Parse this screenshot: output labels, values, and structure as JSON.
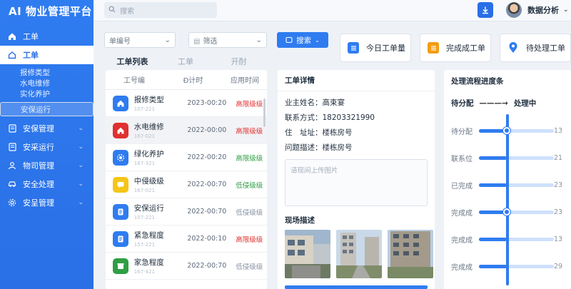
{
  "app": {
    "title": "AI 物业管理平台"
  },
  "search": {
    "placeholder": "搜索"
  },
  "user": {
    "name": "数据分析"
  },
  "sidebar": {
    "items": [
      {
        "label": "工单",
        "icon": "home-icon",
        "active": false,
        "chevron": false
      },
      {
        "label": "工单",
        "icon": "home-outline-icon",
        "active": true,
        "chevron": false
      },
      {
        "label": "安保管理",
        "icon": "doc-icon",
        "active": false,
        "chevron": true
      },
      {
        "label": "安采运行",
        "icon": "doc-icon",
        "active": false,
        "chevron": true
      },
      {
        "label": "物司管理",
        "icon": "person-icon",
        "active": false,
        "chevron": true
      },
      {
        "label": "安全处理",
        "icon": "car-icon",
        "active": false,
        "chevron": true
      },
      {
        "label": "安呈管理",
        "icon": "gear-icon",
        "active": false,
        "chevron": true
      }
    ],
    "subitems": [
      "报修类型",
      "水电维修",
      "实化养护",
      "安保运行"
    ],
    "selected_sub": "安保运行"
  },
  "filters": {
    "order_no": "单编号",
    "filter": "筛选",
    "search_button": "搜索"
  },
  "stats": [
    {
      "label": "今日工单量",
      "color": "#2f7cf0"
    },
    {
      "label": "完成成工单",
      "color": "#f39c12"
    },
    {
      "label": "待处理工单",
      "color": "#2f7cf0"
    }
  ],
  "tabs": [
    "工单列表",
    "工单",
    "开酎"
  ],
  "list": {
    "headers": [
      "工号编",
      "Ð计时",
      "应用时间"
    ],
    "rows": [
      {
        "name": "报修类型",
        "code": "107-221",
        "date": "2023-00:20",
        "priority": "高限级级",
        "pcolor": "#e03131",
        "icon_bg": "#2f7cf0",
        "icon": "home"
      },
      {
        "name": "水电维修",
        "code": "167-021",
        "date": "2022-00:00",
        "priority": "高限级级",
        "pcolor": "#e03131",
        "icon_bg": "#e03131",
        "icon": "home"
      },
      {
        "name": "绿化养护",
        "code": "167-321",
        "date": "2022-00:20",
        "priority": "高限级级",
        "pcolor": "#2f9e44",
        "icon_bg": "#2f7cf0",
        "icon": "gear"
      },
      {
        "name": "中侵级级",
        "code": "167-021",
        "date": "2022-00:70",
        "priority": "低侵级级",
        "pcolor": "#2f9e44",
        "icon_bg": "#f5c518",
        "icon": "chat"
      },
      {
        "name": "安保运行",
        "code": "107-221",
        "date": "2022-00:70",
        "priority": "低侵级级",
        "pcolor": "#8793a3",
        "icon_bg": "#2f7cf0",
        "icon": "doc"
      },
      {
        "name": "紧急程度",
        "code": "157-221",
        "date": "2022-00:10",
        "priority": "高限级级",
        "pcolor": "#e03131",
        "icon_bg": "#2f7cf0",
        "icon": "doc"
      },
      {
        "name": "家急程度",
        "code": "167-421",
        "date": "2022-00:70",
        "priority": "低侵级级",
        "pcolor": "#8793a3",
        "icon_bg": "#2f9e44",
        "icon": "box"
      }
    ]
  },
  "detail": {
    "title": "工单详情",
    "fields": [
      {
        "k": "业主姓名：",
        "v": "高束宴"
      },
      {
        "k": "联系方式：",
        "v": "18203321990"
      },
      {
        "k": "住　址址：",
        "v": "楼栋房号"
      },
      {
        "k": "问题描述：",
        "v": "楼栋房号"
      }
    ],
    "upload_placeholder": "请现间上传图片",
    "photos_title": "现场描述"
  },
  "progress": {
    "title": "处理流程进度条",
    "flow_from": "待分配",
    "flow_to": "处理中",
    "rows": [
      {
        "label": "待分配",
        "value": 13,
        "fraction": 0.37,
        "dot": true
      },
      {
        "label": "联系位",
        "value": 21,
        "fraction": 0.37,
        "dot": false
      },
      {
        "label": "已完成",
        "value": 23,
        "fraction": 0.37,
        "dot": false
      },
      {
        "label": "完成成",
        "value": 23,
        "fraction": 0.37,
        "dot": true
      },
      {
        "label": "完成成",
        "value": 13,
        "fraction": 0.37,
        "dot": false
      },
      {
        "label": "完成成",
        "value": 29,
        "fraction": 0.37,
        "dot": false
      }
    ]
  }
}
